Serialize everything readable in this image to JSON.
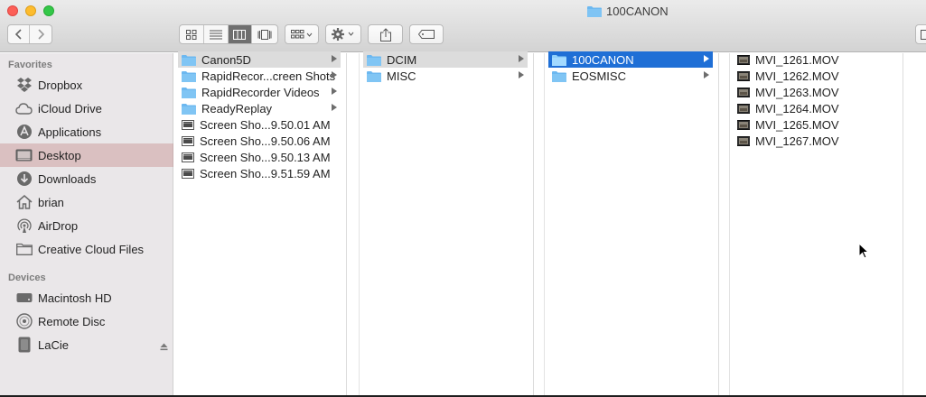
{
  "window": {
    "title": "100CANON"
  },
  "toolbar": {
    "back": "back",
    "forward": "forward",
    "views": [
      "icon-view",
      "list-view",
      "column-view",
      "cover-flow-view"
    ],
    "active_view": "column-view",
    "arrange": "arrange",
    "action": "action",
    "share": "share",
    "tags": "tags"
  },
  "sidebar": {
    "favorites_header": "Favorites",
    "favorites": [
      {
        "label": "Dropbox",
        "icon": "dropbox-icon"
      },
      {
        "label": "iCloud Drive",
        "icon": "cloud-icon"
      },
      {
        "label": "Applications",
        "icon": "applications-icon"
      },
      {
        "label": "Desktop",
        "icon": "desktop-icon",
        "selected": true
      },
      {
        "label": "Downloads",
        "icon": "downloads-icon"
      },
      {
        "label": "brian",
        "icon": "home-icon"
      },
      {
        "label": "AirDrop",
        "icon": "airdrop-icon"
      },
      {
        "label": "Creative Cloud Files",
        "icon": "folder-icon"
      }
    ],
    "devices_header": "Devices",
    "devices": [
      {
        "label": "Macintosh HD",
        "icon": "harddisk-icon"
      },
      {
        "label": "Remote Disc",
        "icon": "disc-icon"
      },
      {
        "label": "LaCie",
        "icon": "external-drive-icon",
        "eject": true
      }
    ]
  },
  "columns": [
    {
      "items": [
        {
          "label": "Canon5D",
          "type": "folder",
          "state": "highlight",
          "arrow": true
        },
        {
          "label": "RapidRecor...creen Shots",
          "type": "folder",
          "arrow": true
        },
        {
          "label": "RapidRecorder Videos",
          "type": "folder",
          "arrow": true
        },
        {
          "label": "ReadyReplay",
          "type": "folder",
          "arrow": true
        },
        {
          "label": "Screen Sho...9.50.01 AM",
          "type": "image"
        },
        {
          "label": "Screen Sho...9.50.06 AM",
          "type": "image"
        },
        {
          "label": "Screen Sho...9.50.13 AM",
          "type": "image"
        },
        {
          "label": "Screen Sho...9.51.59 AM",
          "type": "image"
        }
      ]
    },
    {
      "items": [
        {
          "label": "DCIM",
          "type": "folder",
          "state": "highlight",
          "arrow": true
        },
        {
          "label": "MISC",
          "type": "folder",
          "arrow": true
        }
      ]
    },
    {
      "items": [
        {
          "label": "100CANON",
          "type": "folder",
          "state": "selected",
          "arrow": true
        },
        {
          "label": "EOSMISC",
          "type": "folder",
          "arrow": true
        }
      ]
    },
    {
      "items": [
        {
          "label": "MVI_1261.MOV",
          "type": "video"
        },
        {
          "label": "MVI_1262.MOV",
          "type": "video"
        },
        {
          "label": "MVI_1263.MOV",
          "type": "video"
        },
        {
          "label": "MVI_1264.MOV",
          "type": "video"
        },
        {
          "label": "MVI_1265.MOV",
          "type": "video"
        },
        {
          "label": "MVI_1267.MOV",
          "type": "video"
        }
      ]
    }
  ],
  "colors": {
    "selection": "#1f6fd6",
    "folder": "#6cb8f0",
    "sidebar_selection": "#d6b3b3"
  }
}
